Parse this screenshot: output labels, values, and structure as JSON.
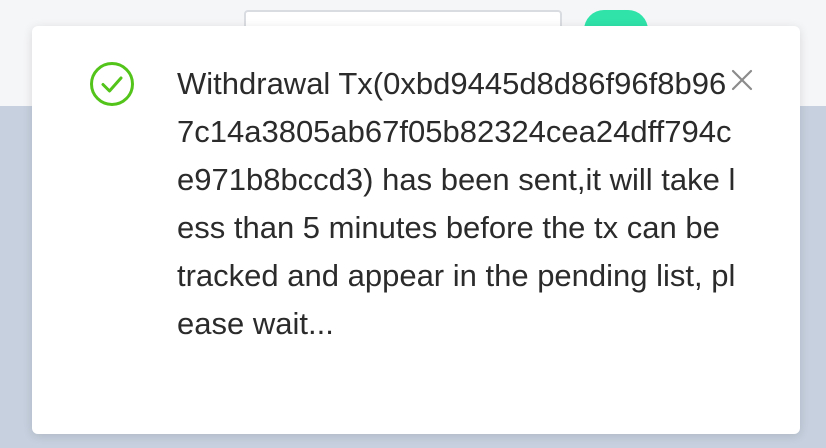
{
  "background": {
    "colors": {
      "top_band": "#f5f6f8",
      "page": "#c6d0de",
      "button_accent": "#2fe3a9"
    }
  },
  "notification": {
    "icon": "check-circle-icon",
    "icon_color": "#52c41a",
    "message": "Withdrawal Tx(0xbd9445d8d86f96f8b967c14a3805ab67f05b82324cea24dff794ce971b8bccd3) has been sent,it will take less than 5 minutes before the tx can be tracked and appear in the pending list, please wait...",
    "close_icon": "close-icon"
  }
}
